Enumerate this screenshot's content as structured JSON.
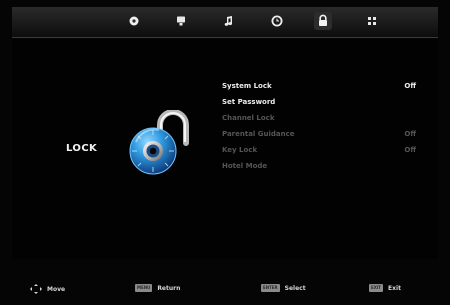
{
  "page": {
    "title": "LOCK"
  },
  "top_menu": {
    "items": [
      {
        "icon": "picture-icon"
      },
      {
        "icon": "screen-icon"
      },
      {
        "icon": "music-icon"
      },
      {
        "icon": "clock-icon"
      },
      {
        "icon": "lock-icon",
        "active": true
      },
      {
        "icon": "grid-icon"
      }
    ]
  },
  "lock_menu": {
    "items": [
      {
        "label": "System Lock",
        "value": "Off",
        "enabled": true
      },
      {
        "label": "Set Password",
        "value": "",
        "enabled": true
      },
      {
        "label": "Channel Lock",
        "value": "",
        "enabled": false
      },
      {
        "label": "Parental Guidance",
        "value": "Off",
        "enabled": false
      },
      {
        "label": "Key Lock",
        "value": "Off",
        "enabled": false
      },
      {
        "label": "Hotel Mode",
        "value": "",
        "enabled": false
      }
    ]
  },
  "footer": {
    "move_label": "Move",
    "menu_key": "MENU",
    "return_label": "Return",
    "enter_key": "ENTER",
    "select_label": "Select",
    "exit_key": "EXIT",
    "exit_label": "Exit"
  },
  "colors": {
    "background": "#050505",
    "text": "#f3f3f3",
    "disabled_text": "#555555",
    "accent_blue": "#43a9e8"
  }
}
